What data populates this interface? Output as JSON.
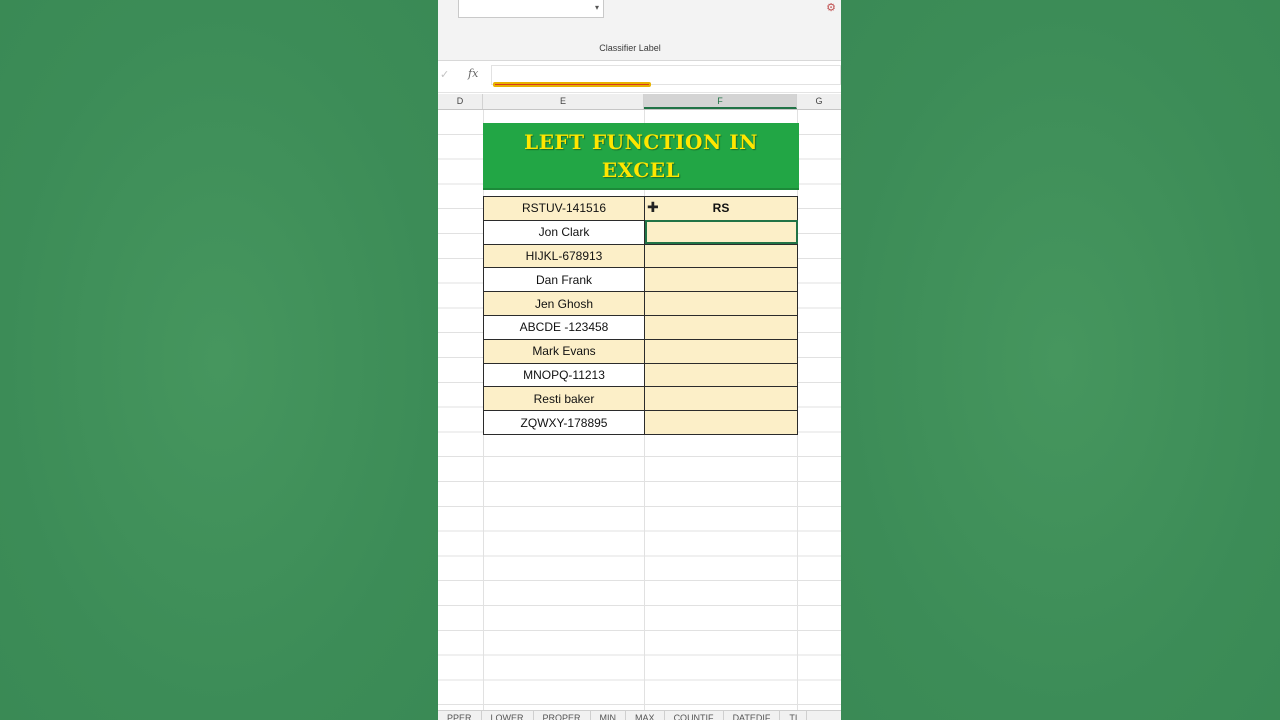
{
  "ribbon": {
    "dropdown_value": "",
    "classifier_label": "Classifier Label"
  },
  "formula_bar": {
    "fx_label": "fx",
    "value": ""
  },
  "columns": [
    "D",
    "E",
    "F",
    "G"
  ],
  "selected_column": "F",
  "title": "LEFT FUNCTION IN EXCEL",
  "rows": [
    {
      "e": "RSTUV-141516",
      "f": "RS"
    },
    {
      "e": "Jon Clark",
      "f": ""
    },
    {
      "e": "HIJKL-678913",
      "f": ""
    },
    {
      "e": "Dan Frank",
      "f": ""
    },
    {
      "e": "Jen Ghosh",
      "f": ""
    },
    {
      "e": "ABCDE -123458",
      "f": ""
    },
    {
      "e": "Mark Evans",
      "f": ""
    },
    {
      "e": "MNOPQ-11213",
      "f": ""
    },
    {
      "e": "Resti baker",
      "f": ""
    },
    {
      "e": "ZQWXY-178895",
      "f": ""
    }
  ],
  "sheet_tabs": [
    "PPER",
    "LOWER",
    "PROPER",
    "MIN",
    "MAX",
    "COUNTIF",
    "DATEDIF",
    "TI"
  ],
  "colors": {
    "title_bg": "#22a645",
    "title_text": "#ffe600",
    "cell_highlight": "#fcefc8",
    "background": "#3f8f59",
    "excel_green": "#217346"
  }
}
